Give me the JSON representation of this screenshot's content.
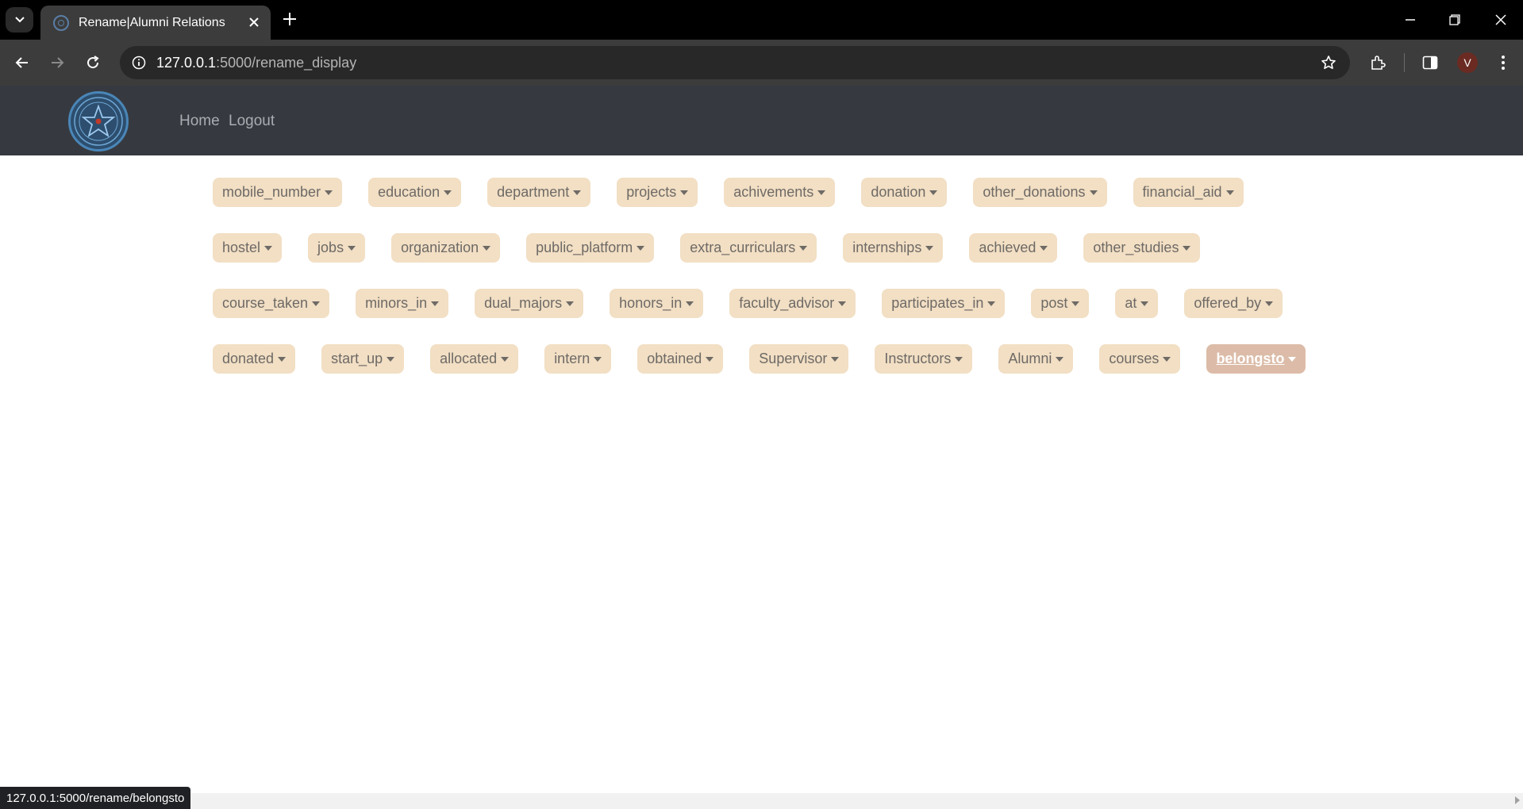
{
  "browser": {
    "tab_title": "Rename|Alumni Relations",
    "url_host": "127.0.0.1",
    "url_path": ":5000/rename_display",
    "profile_initial": "V",
    "status_url": "127.0.0.1:5000/rename/belongsto"
  },
  "navbar": {
    "links": [
      "Home",
      "Logout"
    ]
  },
  "chips": [
    {
      "label": "mobile_number",
      "active": false
    },
    {
      "label": "education",
      "active": false
    },
    {
      "label": "department",
      "active": false
    },
    {
      "label": "projects",
      "active": false
    },
    {
      "label": "achivements",
      "active": false
    },
    {
      "label": "donation",
      "active": false
    },
    {
      "label": "other_donations",
      "active": false
    },
    {
      "label": "financial_aid",
      "active": false
    },
    {
      "label": "hostel",
      "active": false
    },
    {
      "label": "jobs",
      "active": false
    },
    {
      "label": "organization",
      "active": false
    },
    {
      "label": "public_platform",
      "active": false
    },
    {
      "label": "extra_curriculars",
      "active": false
    },
    {
      "label": "internships",
      "active": false
    },
    {
      "label": "achieved",
      "active": false
    },
    {
      "label": "other_studies",
      "active": false
    },
    {
      "label": "course_taken",
      "active": false
    },
    {
      "label": "minors_in",
      "active": false
    },
    {
      "label": "dual_majors",
      "active": false
    },
    {
      "label": "honors_in",
      "active": false
    },
    {
      "label": "faculty_advisor",
      "active": false
    },
    {
      "label": "participates_in",
      "active": false
    },
    {
      "label": "post",
      "active": false
    },
    {
      "label": "at",
      "active": false
    },
    {
      "label": "offered_by",
      "active": false
    },
    {
      "label": "donated",
      "active": false
    },
    {
      "label": "start_up",
      "active": false
    },
    {
      "label": "allocated",
      "active": false
    },
    {
      "label": "intern",
      "active": false
    },
    {
      "label": "obtained",
      "active": false
    },
    {
      "label": "Supervisor",
      "active": false
    },
    {
      "label": "Instructors",
      "active": false
    },
    {
      "label": "Alumni",
      "active": false
    },
    {
      "label": "courses",
      "active": false
    },
    {
      "label": "belongsto",
      "active": true
    }
  ],
  "colors": {
    "chip_bg": "#f2dfc4",
    "chip_active_bg": "#dcbca8",
    "navbar_bg": "#363a40"
  }
}
